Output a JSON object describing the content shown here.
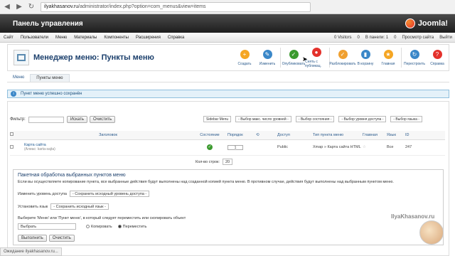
{
  "browser": {
    "url_host": "ilyakhasanov.ru",
    "url_path": "/administrator/index.php?option=com_menus&view=items"
  },
  "header": {
    "title": "Панель управления",
    "logo_text": "Joomla!"
  },
  "menu": {
    "items": [
      "Сайт",
      "Пользователи",
      "Меню",
      "Материалы",
      "Компоненты",
      "Расширения",
      "Справка"
    ],
    "right": [
      "0 Visitors",
      "0",
      "В панели: 1",
      "0",
      "Просмотр сайта",
      "Выйти"
    ]
  },
  "toolbar": {
    "title": "Менеджер меню: Пункты меню",
    "buttons": [
      {
        "label": "Создать",
        "color": "#f5a623",
        "icon": "plus-icon"
      },
      {
        "label": "Изменить",
        "color": "#3a87c8",
        "icon": "edit-icon"
      },
      {
        "label": "Опубликовать",
        "color": "#3b9a2e",
        "icon": "check-icon"
      },
      {
        "label": "Снять с публикац.",
        "color": "#e4312b",
        "icon": "unpublish-icon"
      },
      {
        "label": "Разблокировать",
        "color": "#f0a030",
        "icon": "checkin-icon"
      },
      {
        "label": "В корзину",
        "color": "#3a87c8",
        "icon": "trash-icon"
      },
      {
        "label": "Главная",
        "color": "#f5a623",
        "icon": "star-icon"
      },
      {
        "label": "Перестроить",
        "color": "#3a87c8",
        "icon": "refresh-icon"
      },
      {
        "label": "Справка",
        "color": "#e4312b",
        "icon": "help-icon"
      }
    ]
  },
  "subnav": {
    "menus": "Меню",
    "items": "Пункты меню"
  },
  "message": "Пункт меню успешно сохранён",
  "filter": {
    "label": "Фильтр:",
    "search_btn": "Искать",
    "clear_btn": "Очистить",
    "selects": [
      "Sidebar Menu",
      "- Выбор макс. число уровней -",
      "- Выбор состояния -",
      "- Выбор уровня доступа -",
      "- Выбор языка -"
    ]
  },
  "table": {
    "headers": [
      "Заголовок",
      "Состояние",
      "Порядок",
      "Доступ",
      "Тип пункта меню",
      "Главная",
      "Язык",
      "ID"
    ],
    "rows": [
      {
        "title": "Карта сайта",
        "alias": "(Алиас: karta-sajta)",
        "order": "1",
        "access": "Public",
        "type": "Xmap » Карта сайта HTML",
        "lang": "Все",
        "id": "247"
      }
    ]
  },
  "pager": {
    "label": "Кол-во строк:",
    "value": "20"
  },
  "batch": {
    "legend": "Пакетная обработка выбранных пунктов меню",
    "help": "Если вы осуществляете копирование пункта, все выбранные действия будут выполнены над созданной копией пункта меню. В противном случае, действия будут выполнены над выбранным пунктом меню.",
    "access_label": "Изменить уровень доступа",
    "access_sel": "- Сохранить исходный уровень доступа -",
    "lang_label": "Установить язык",
    "lang_sel": "- Сохранить исходный язык -",
    "move_label": "Выберите 'Меню' или 'Пункт меню', в который следует переместить или скопировать объект",
    "move_sel": "Выбрать",
    "copy": "Копировать",
    "move": "Переместить",
    "run": "Выполнить",
    "clear": "Очистить"
  },
  "status": "Ожидание ilyakhasanov.ru...",
  "watermark": "IlyaKhasanov.ru"
}
